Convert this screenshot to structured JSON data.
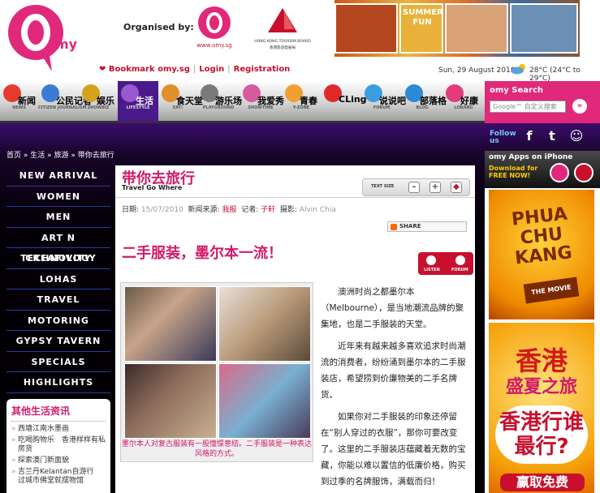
{
  "header": {
    "organised_by": "Organised by:",
    "omy_url": "www.omy.sg",
    "hktb_name": "HONG KONG TOURISM BOARD",
    "hktb_cn": "香港旅遊發展局",
    "banner_text": "SUMMER FUN",
    "bookmark": "Bookmark omy.sg",
    "login": "Login",
    "registration": "Registration",
    "date": "Sun, 29 August 2010",
    "temperature": "28°C  (24°C to 29°C)"
  },
  "nav": [
    {
      "cn": "新闻",
      "en": "NEWS",
      "color": "#e53b2c"
    },
    {
      "cn": "公民记者",
      "en": "CITIZEN JOURNALISM",
      "color": "#3b7bd5"
    },
    {
      "cn": "娱乐",
      "en": "SHOWBIZ",
      "color": "#d4a21b"
    },
    {
      "cn": "生活",
      "en": "LIFESTYLE",
      "color": "#9b59d0",
      "active": true
    },
    {
      "cn": "食天堂",
      "en": "EAT!",
      "color": "#e0902a"
    },
    {
      "cn": "游乐场",
      "en": "PLAYGROUND",
      "color": "#7a7a7a"
    },
    {
      "cn": "我爱秀",
      "en": "SHOWTIME",
      "color": "#d85a9e"
    },
    {
      "cn": "青春",
      "en": "Y-ZONE",
      "color": "#f0a030"
    },
    {
      "cn": "CLing",
      "en": "",
      "color": "#e02a2a"
    },
    {
      "cn": "说说吧",
      "en": "FORUM",
      "color": "#3a9ee0"
    },
    {
      "cn": "部落格",
      "en": "BLOG",
      "color": "#2a8ad8"
    },
    {
      "cn": "好康",
      "en": "LOBANG",
      "color": "#e53b7c"
    }
  ],
  "search": {
    "label": "omy Search",
    "placeholder": "Google™ 自定义搜索",
    "go": "»"
  },
  "breadcrumb": [
    "首页",
    "生活",
    "旅游",
    "带你去旅行"
  ],
  "menu": [
    "NEW ARRIVAL",
    "WOMEN",
    "MEN",
    "ART N CREATIVITY",
    "TECHNOLOGY",
    "LOHAS",
    "TRAVEL",
    "MOTORING",
    "GYPSY TAVERN",
    "SPECIALS",
    "HIGHLIGHTS"
  ],
  "other": {
    "title": "其他生活资讯",
    "items": [
      "西塘江南水墨画",
      "吃喝购物乐　香港样样有私房货",
      "探索澳门新面貌",
      "吉兰丹Kelantan自游行　过城市佛堂就摆物馆"
    ]
  },
  "article": {
    "section_title": "带你去旅行",
    "section_sub": "Travel Go Where",
    "text_size": "TEXT SIZE",
    "date_label": "日期:",
    "date": "15/07/2010",
    "source_label": "新闻来源:",
    "source": "我报",
    "reporter_label": "记者:",
    "reporter": "子轩",
    "photo_label": "摄影:",
    "photographer": "Alvin Chia",
    "share": "SHARE",
    "headline": "二手服装，墨尔本一流！",
    "listen": "LISTEN",
    "forum": "FORUM",
    "caption": "墨尔本人对复古服装有一股憧憬意结。二手服装是一种表达风格的方式。",
    "paragraphs": [
      "澳洲时尚之都墨尔本（Melbourne），是当地潮流品牌的聚集地，也是二手服装的天堂。",
      "近年来有越来越多喜欢追求时尚潮流的消费者，纷纷涌到墨尔本的二手服装店，希望捞到价廉物美的二手名牌货。",
      "如果你对二手服装的印象还停留在“别人穿过的衣服”，那你可要改变了。这里的二手服装店蕴藏着无数的宝藏，你能以难以置信的低廉价格，购买到过季的名牌服饰，满载而归！"
    ]
  },
  "right": {
    "follow_label": "Follow us",
    "apps_title": "omy Apps on iPhone",
    "apps_download": "Download for FREE NOW!",
    "ad1_text": "PHUA CHU KANG",
    "ad1_sub": "THE MOVIE",
    "ad2_l1": "香港",
    "ad2_l2": "盛夏之旅",
    "ad2_l3": "香港行谁最行?",
    "ad2_l4": "赢取免费"
  }
}
